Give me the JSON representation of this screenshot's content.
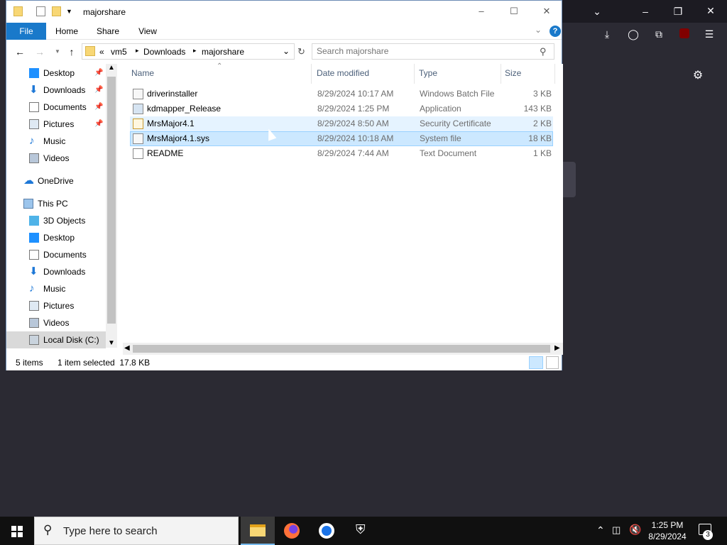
{
  "window": {
    "title": "majorshare"
  },
  "ribbon": {
    "tabs": [
      "File",
      "Home",
      "Share",
      "View"
    ]
  },
  "address": {
    "sep": "«",
    "crumbs": [
      "vm5",
      "Downloads",
      "majorshare"
    ]
  },
  "search": {
    "placeholder": "Search majorshare"
  },
  "nav": {
    "items": [
      {
        "label": "Desktop",
        "icon": "desktop-icon",
        "pinned": true
      },
      {
        "label": "Downloads",
        "icon": "download-arrow-icon",
        "pinned": true
      },
      {
        "label": "Documents",
        "icon": "document-icon",
        "pinned": true
      },
      {
        "label": "Pictures",
        "icon": "picture-icon",
        "pinned": true
      },
      {
        "label": "Music",
        "icon": "music-note-icon",
        "pinned": false
      },
      {
        "label": "Videos",
        "icon": "video-icon",
        "pinned": false
      },
      {
        "label": "OneDrive",
        "icon": "cloud-icon",
        "pinned": false
      },
      {
        "label": "This PC",
        "icon": "computer-icon",
        "pinned": false
      },
      {
        "label": "3D Objects",
        "icon": "cube-icon",
        "pinned": false
      },
      {
        "label": "Desktop",
        "icon": "desktop-icon",
        "pinned": false
      },
      {
        "label": "Documents",
        "icon": "document-icon",
        "pinned": false
      },
      {
        "label": "Downloads",
        "icon": "download-arrow-icon",
        "pinned": false
      },
      {
        "label": "Music",
        "icon": "music-note-icon",
        "pinned": false
      },
      {
        "label": "Pictures",
        "icon": "picture-icon",
        "pinned": false
      },
      {
        "label": "Videos",
        "icon": "video-icon",
        "pinned": false
      },
      {
        "label": "Local Disk (C:)",
        "icon": "drive-icon",
        "pinned": false
      }
    ]
  },
  "columns": [
    "Name",
    "Date modified",
    "Type",
    "Size"
  ],
  "files": [
    {
      "name": "driverinstaller",
      "date": "8/29/2024 10:17 AM",
      "type": "Windows Batch File",
      "size": "3 KB",
      "icon": "batch-file-icon"
    },
    {
      "name": "kdmapper_Release",
      "date": "8/29/2024 1:25 PM",
      "type": "Application",
      "size": "143 KB",
      "icon": "application-icon"
    },
    {
      "name": "MrsMajor4.1",
      "date": "8/29/2024 8:50 AM",
      "type": "Security Certificate",
      "size": "2 KB",
      "icon": "certificate-icon"
    },
    {
      "name": "MrsMajor4.1.sys",
      "date": "8/29/2024 10:18 AM",
      "type": "System file",
      "size": "18 KB",
      "icon": "system-file-icon"
    },
    {
      "name": "README",
      "date": "8/29/2024 7:44 AM",
      "type": "Text Document",
      "size": "1 KB",
      "icon": "text-document-icon"
    }
  ],
  "status": {
    "count": "5 items",
    "selection": "1 item selected  17.8 KB"
  },
  "taskbar": {
    "search_placeholder": "Type here to search",
    "time": "1:25 PM",
    "date": "8/29/2024",
    "notifications": "3"
  },
  "colors": {
    "accent": "#1979ca",
    "selected": "#cce8ff",
    "hover": "#e5f3ff",
    "taskbar": "#101010"
  }
}
